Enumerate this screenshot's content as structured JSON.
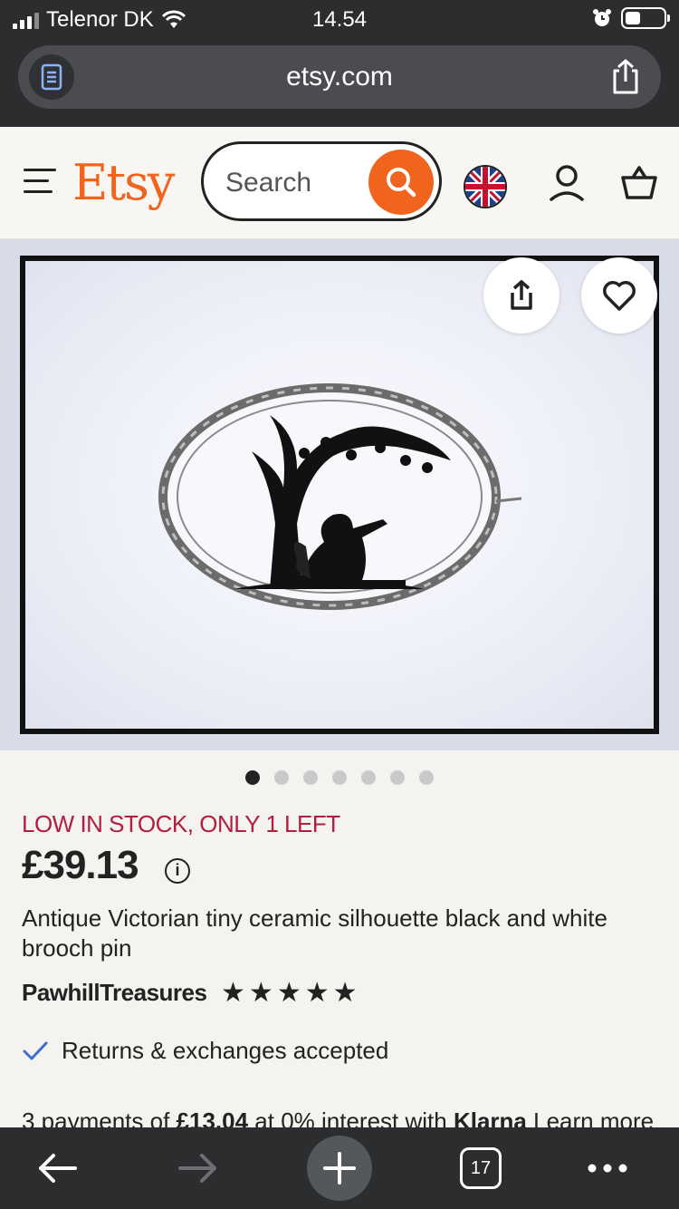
{
  "status_bar": {
    "carrier": "Telenor DK",
    "time": "14.54"
  },
  "browser": {
    "url": "etsy.com",
    "tab_count": "17"
  },
  "header": {
    "logo": "Etsy",
    "search_placeholder": "Search",
    "accent_color": "#f1641e"
  },
  "gallery": {
    "image_count": 7,
    "active_index": 0
  },
  "product": {
    "stock_notice": "LOW IN STOCK, ONLY 1 LEFT",
    "price": "£39.13",
    "title": "Antique Victorian tiny ceramic silhouette black and white brooch pin",
    "shop_name": "PawhillTreasures",
    "rating_stars": 5,
    "returns": "Returns & exchanges accepted",
    "klarna": {
      "prefix": "3 payments of ",
      "amount": "£13.04",
      "middle": " at 0% interest with ",
      "brand": "Klarna",
      "link": " Learn more"
    }
  },
  "icons": {
    "reader": "reader-icon",
    "share": "share-icon",
    "menu": "hamburger-icon",
    "search": "search-icon",
    "flag": "uk-flag-icon",
    "account": "user-icon",
    "cart": "bag-icon",
    "favorite": "heart-icon",
    "info": "info-icon",
    "check": "check-icon",
    "back": "back-arrow-icon",
    "forward": "forward-arrow-icon",
    "new_tab": "plus-icon",
    "more": "more-icon"
  }
}
